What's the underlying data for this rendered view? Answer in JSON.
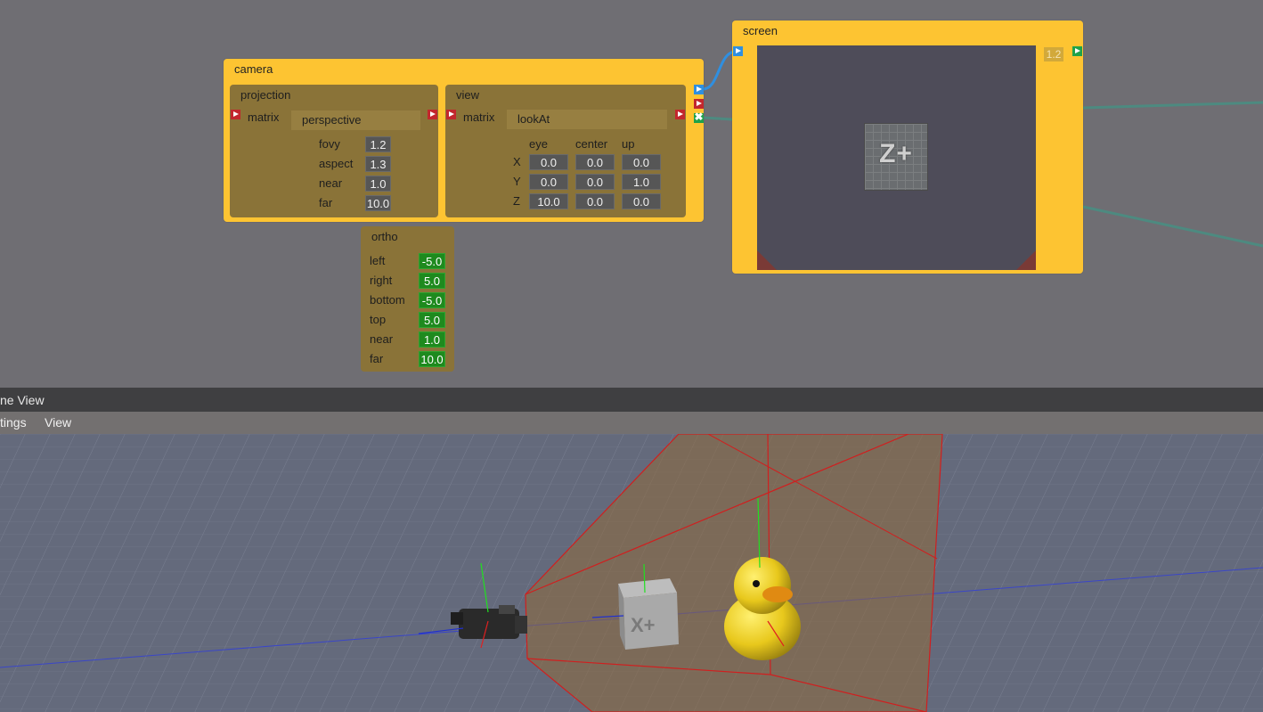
{
  "graph": {
    "camera_node": {
      "title": "camera",
      "projection": {
        "title": "projection",
        "matrix_label": "matrix",
        "type": "perspective",
        "params": [
          {
            "label": "fovy",
            "value": "1.2"
          },
          {
            "label": "aspect",
            "value": "1.3"
          },
          {
            "label": "near",
            "value": "1.0"
          },
          {
            "label": "far",
            "value": "10.0"
          }
        ]
      },
      "view": {
        "title": "view",
        "matrix_label": "matrix",
        "type": "lookAt",
        "columns": [
          "eye",
          "center",
          "up"
        ],
        "rows": [
          {
            "axis": "X",
            "eye": "0.0",
            "center": "0.0",
            "up": "0.0"
          },
          {
            "axis": "Y",
            "eye": "0.0",
            "center": "0.0",
            "up": "1.0"
          },
          {
            "axis": "Z",
            "eye": "10.0",
            "center": "0.0",
            "up": "0.0"
          }
        ]
      }
    },
    "ortho_node": {
      "title": "ortho",
      "params": [
        {
          "label": "left",
          "value": "-5.0"
        },
        {
          "label": "right",
          "value": "5.0"
        },
        {
          "label": "bottom",
          "value": "-5.0"
        },
        {
          "label": "top",
          "value": "5.0"
        },
        {
          "label": "near",
          "value": "1.0"
        },
        {
          "label": "far",
          "value": "10.0"
        }
      ]
    },
    "screen_node": {
      "title": "screen",
      "badge": "1.2",
      "preview_label": "Z+"
    }
  },
  "scene_panel": {
    "title": "ne View",
    "menu": [
      "tings",
      "View"
    ],
    "cube_label": "X+"
  },
  "colors": {
    "node": "#fdc432",
    "subpanel": "#8a7338",
    "port_red": "#c2272d",
    "port_blue": "#2f8fe0",
    "port_green": "#1fa24a",
    "frustum": "#d01f1f"
  }
}
